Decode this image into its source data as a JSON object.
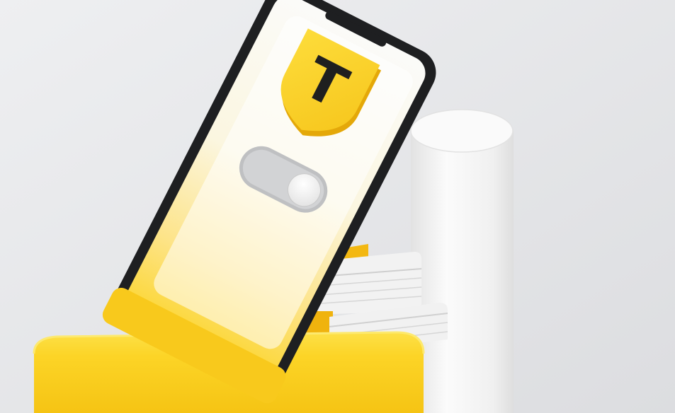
{
  "scene": {
    "shield_letter": "T",
    "toggle_state": "off"
  },
  "colors": {
    "background_light": "#eeeff1",
    "background_dark": "#d9dadd",
    "brand_yellow": "#fcd426",
    "yellow_deep": "#f2b60c",
    "phone_black": "#1e1f21",
    "screen_white": "#fbfbf9",
    "toggle_track": "#bfc0c2",
    "cylinder_white": "#f4f4f4"
  },
  "icons": [
    "shield-icon",
    "toggle-switch-icon"
  ]
}
